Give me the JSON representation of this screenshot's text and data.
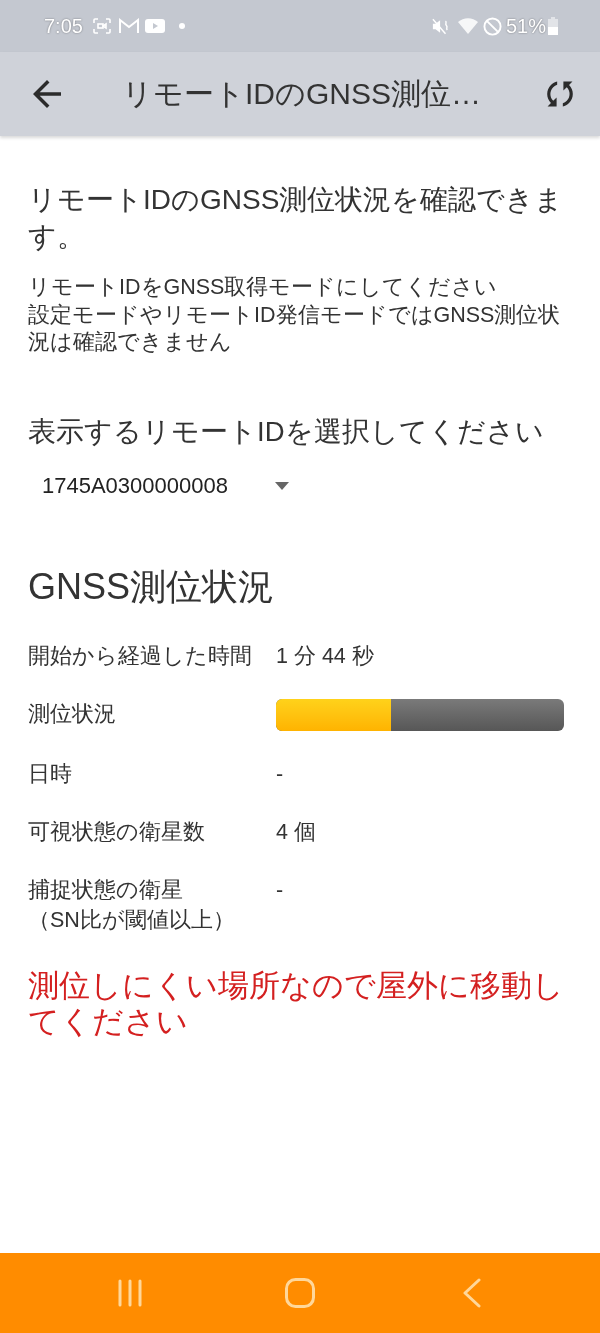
{
  "status_bar": {
    "time": "7:05",
    "battery": "51%"
  },
  "app_bar": {
    "title": "リモートIDのGNSS測位…"
  },
  "intro": {
    "heading": "リモートIDのGNSS測位状況を確認できます。",
    "note_lines": [
      "リモートIDをGNSS取得モードにしてください",
      "設定モードやリモートID発信モードではGNSS測位状況は確認できません"
    ]
  },
  "device_select": {
    "label": "表示するリモートIDを選択してください",
    "value": "1745A0300000008"
  },
  "gnss_status": {
    "heading": "GNSS測位状況",
    "rows": [
      {
        "kind": "text",
        "label_lines": [
          "開始から経過した時間"
        ],
        "value": "1 分 44 秒"
      },
      {
        "kind": "progress",
        "label_lines": [
          "測位状況"
        ],
        "level": 0.4
      },
      {
        "kind": "text",
        "label_lines": [
          "日時"
        ],
        "value": "-"
      },
      {
        "kind": "text",
        "label_lines": [
          "可視状態の衛星数"
        ],
        "value": "4 個"
      },
      {
        "kind": "text",
        "label_lines": [
          "捕捉状態の衛星",
          "（SN比が閾値以上）"
        ],
        "value": "-"
      }
    ],
    "warning": "測位しにくい場所なので屋外に移動してください"
  }
}
